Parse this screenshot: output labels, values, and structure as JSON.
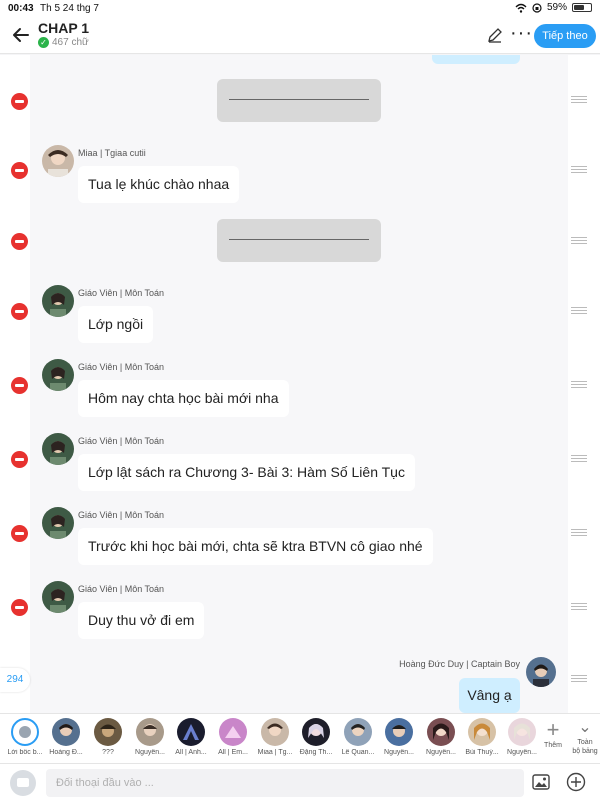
{
  "status": {
    "time": "00:43",
    "date": "Th 5 24 thg 7",
    "battery": "59%"
  },
  "header": {
    "title": "CHAP 1",
    "word_count": "467 chữ",
    "next_label": "Tiếp theo"
  },
  "messages": [
    {
      "sender": "Miaa | Tgiaa cutii",
      "text": "Tua lẹ khúc chào nhaa"
    },
    {
      "sender": "Giáo Viên | Môn Toán",
      "text": "Lớp ngồi"
    },
    {
      "sender": "Giáo Viên | Môn Toán",
      "text": "Hôm nay chta học bài mới nha"
    },
    {
      "sender": "Giáo Viên | Môn Toán",
      "text": "Lớp lật sách ra Chương 3- Bài 3: Hàm Số Liên Tục"
    },
    {
      "sender": "Giáo Viên | Môn Toán",
      "text": "Trước khi học bài mới, chta sẽ ktra BTVN cô giao nhé"
    },
    {
      "sender": "Giáo Viên | Môn Toán",
      "text": "Duy thu vở đi em"
    }
  ],
  "reply": {
    "sender": "Hoàng Đức Duy | Captain Boy",
    "text": "Vâng ạ"
  },
  "side_badge": "294",
  "characters": [
    "Lời bốc b...",
    "Hoàng Đ...",
    "???",
    "Nguyễn...",
    "All | Anh...",
    "All | Em...",
    "Miaa | Tg...",
    "Đặng Th...",
    "Lê Quan...",
    "Nguyễn...",
    "Nguyễn...",
    "Bùi Thuý...",
    "Nguyễn..."
  ],
  "strip_actions": {
    "add": "Thêm",
    "all_line1": "Toàn",
    "all_line2": "bộ bảng"
  },
  "input": {
    "placeholder": "Đối thoại đầu vào ..."
  },
  "colors": {
    "accent": "#2a9df4",
    "delete": "#e7322f",
    "reply_bubble": "#cfeeff"
  }
}
